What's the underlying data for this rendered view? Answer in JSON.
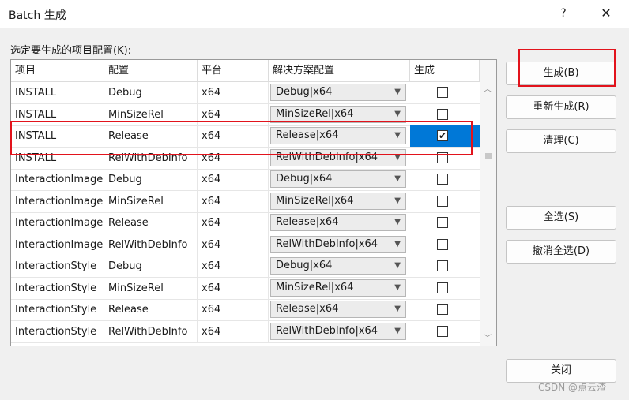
{
  "window": {
    "title": "Batch 生成",
    "help": "?",
    "close": "✕"
  },
  "prompt": "选定要生成的项目配置(K):",
  "columns": [
    "项目",
    "配置",
    "平台",
    "解决方案配置",
    "生成"
  ],
  "rows": [
    {
      "project": "INSTALL",
      "config": "Debug",
      "platform": "x64",
      "solution": "Debug|x64",
      "checked": ""
    },
    {
      "project": "INSTALL",
      "config": "MinSizeRel",
      "platform": "x64",
      "solution": "MinSizeRel|x64",
      "checked": ""
    },
    {
      "project": "INSTALL",
      "config": "Release",
      "platform": "x64",
      "solution": "Release|x64",
      "checked": "✔"
    },
    {
      "project": "INSTALL",
      "config": "RelWithDebInfo",
      "platform": "x64",
      "solution": "RelWithDebInfo|x64",
      "checked": ""
    },
    {
      "project": "InteractionImage",
      "config": "Debug",
      "platform": "x64",
      "solution": "Debug|x64",
      "checked": ""
    },
    {
      "project": "InteractionImage",
      "config": "MinSizeRel",
      "platform": "x64",
      "solution": "MinSizeRel|x64",
      "checked": ""
    },
    {
      "project": "InteractionImage",
      "config": "Release",
      "platform": "x64",
      "solution": "Release|x64",
      "checked": ""
    },
    {
      "project": "InteractionImage",
      "config": "RelWithDebInfo",
      "platform": "x64",
      "solution": "RelWithDebInfo|x64",
      "checked": ""
    },
    {
      "project": "InteractionStyle",
      "config": "Debug",
      "platform": "x64",
      "solution": "Debug|x64",
      "checked": ""
    },
    {
      "project": "InteractionStyle",
      "config": "MinSizeRel",
      "platform": "x64",
      "solution": "MinSizeRel|x64",
      "checked": ""
    },
    {
      "project": "InteractionStyle",
      "config": "Release",
      "platform": "x64",
      "solution": "Release|x64",
      "checked": ""
    },
    {
      "project": "InteractionStyle",
      "config": "RelWithDebInfo",
      "platform": "x64",
      "solution": "RelWithDebInfo|x64",
      "checked": ""
    }
  ],
  "buttons": {
    "build": "生成(B)",
    "rebuild": "重新生成(R)",
    "clean": "清理(C)",
    "select_all": "全选(S)",
    "deselect_all": "撤消全选(D)",
    "close": "关闭"
  },
  "watermark": "CSDN @点云渣",
  "colors": {
    "selection": "#0078d7",
    "highlight_box": "#e2131c"
  }
}
